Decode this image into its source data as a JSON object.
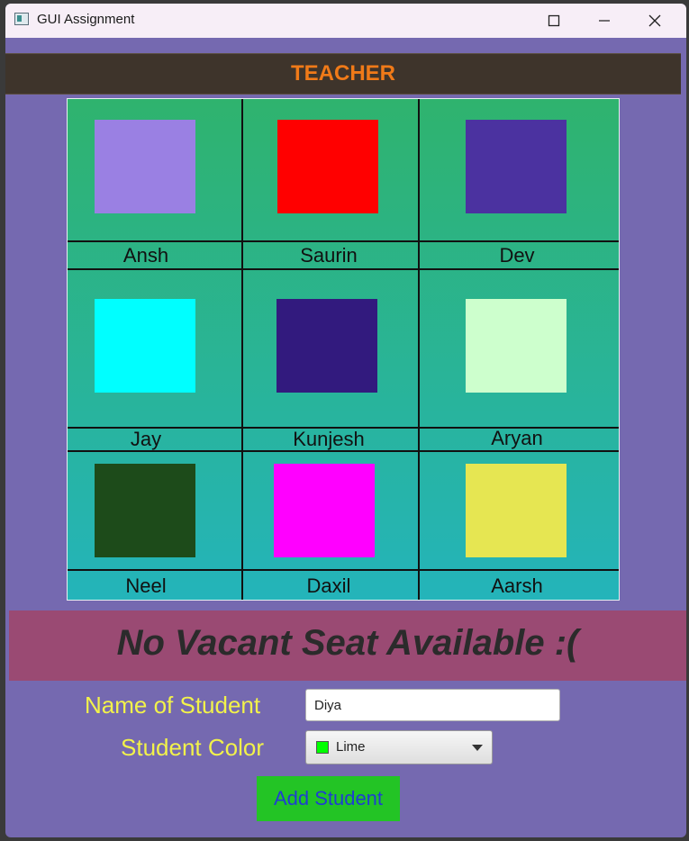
{
  "window": {
    "title": "GUI Assignment",
    "controls": [
      {
        "name": "minimize",
        "icon": "minimize-icon"
      },
      {
        "name": "maximize",
        "icon": "maximize-icon"
      },
      {
        "name": "close",
        "icon": "close-icon"
      }
    ]
  },
  "header": {
    "label": "TEACHER"
  },
  "seats": [
    {
      "name": "Ansh",
      "color": "#9a80e3"
    },
    {
      "name": "Saurin",
      "color": "#ff0000"
    },
    {
      "name": "Dev",
      "color": "#4b32a0"
    },
    {
      "name": "Jay",
      "color": "#00ffff"
    },
    {
      "name": "Kunjesh",
      "color": "#321a7e"
    },
    {
      "name": "Aryan",
      "color": "#cdffcd"
    },
    {
      "name": "Neel",
      "color": "#1d4b1a"
    },
    {
      "name": "Daxil",
      "color": "#ff00ff"
    },
    {
      "name": "Aarsh",
      "color": "#e6e652"
    }
  ],
  "status": {
    "message": "No Vacant Seat Available :("
  },
  "form": {
    "name_label": "Name of Student",
    "name_value": "Diya",
    "color_label": "Student Color",
    "color_selected": "Lime",
    "color_swatch": "#00ff00",
    "add_button": "Add Student"
  },
  "colors": {
    "background": "#7569b0",
    "header_bg": "#3e342b",
    "header_text": "#f07a18",
    "banner_bg": "#9a4a73",
    "label_text": "#f2f24a",
    "button_bg": "#23c425",
    "button_text": "#1f3ed1"
  }
}
